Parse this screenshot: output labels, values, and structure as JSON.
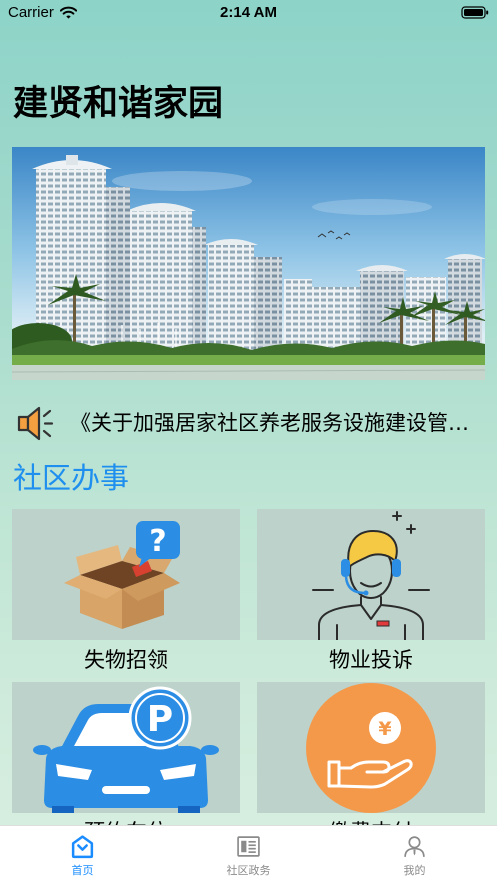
{
  "status_bar": {
    "carrier": "Carrier",
    "time": "2:14 AM",
    "icons": [
      "wifi-icon",
      "battery-icon"
    ]
  },
  "header": {
    "title": "建贤和谐家园"
  },
  "notice": {
    "icon": "speaker-icon",
    "text": "《关于加强居家社区养老服务设施建设管…"
  },
  "section": {
    "title": "社区办事"
  },
  "services": [
    {
      "label": "失物招领",
      "icon": "question-box-icon",
      "icon_glyph": "?"
    },
    {
      "label": "物业投诉",
      "icon": "customer-service-agent-icon"
    },
    {
      "label": "预约车位",
      "icon": "parking-car-icon",
      "icon_glyph": "P"
    },
    {
      "label": "缴费支付",
      "icon": "hand-coin-icon",
      "icon_glyph": "¥"
    }
  ],
  "tab_bar": {
    "tabs": [
      {
        "label": "首页",
        "icon": "home-icon",
        "active": true
      },
      {
        "label": "社区政务",
        "icon": "newspaper-icon",
        "active": false
      },
      {
        "label": "我的",
        "icon": "profile-icon",
        "active": false
      }
    ]
  },
  "colors": {
    "accent": "#1a8cff",
    "section_title": "#1e8fee",
    "tab_inactive": "#8a8a8a",
    "tile_background": "#bcd2ca",
    "icon_blue": "#2b8de3",
    "payment_orange": "#f4994a"
  }
}
